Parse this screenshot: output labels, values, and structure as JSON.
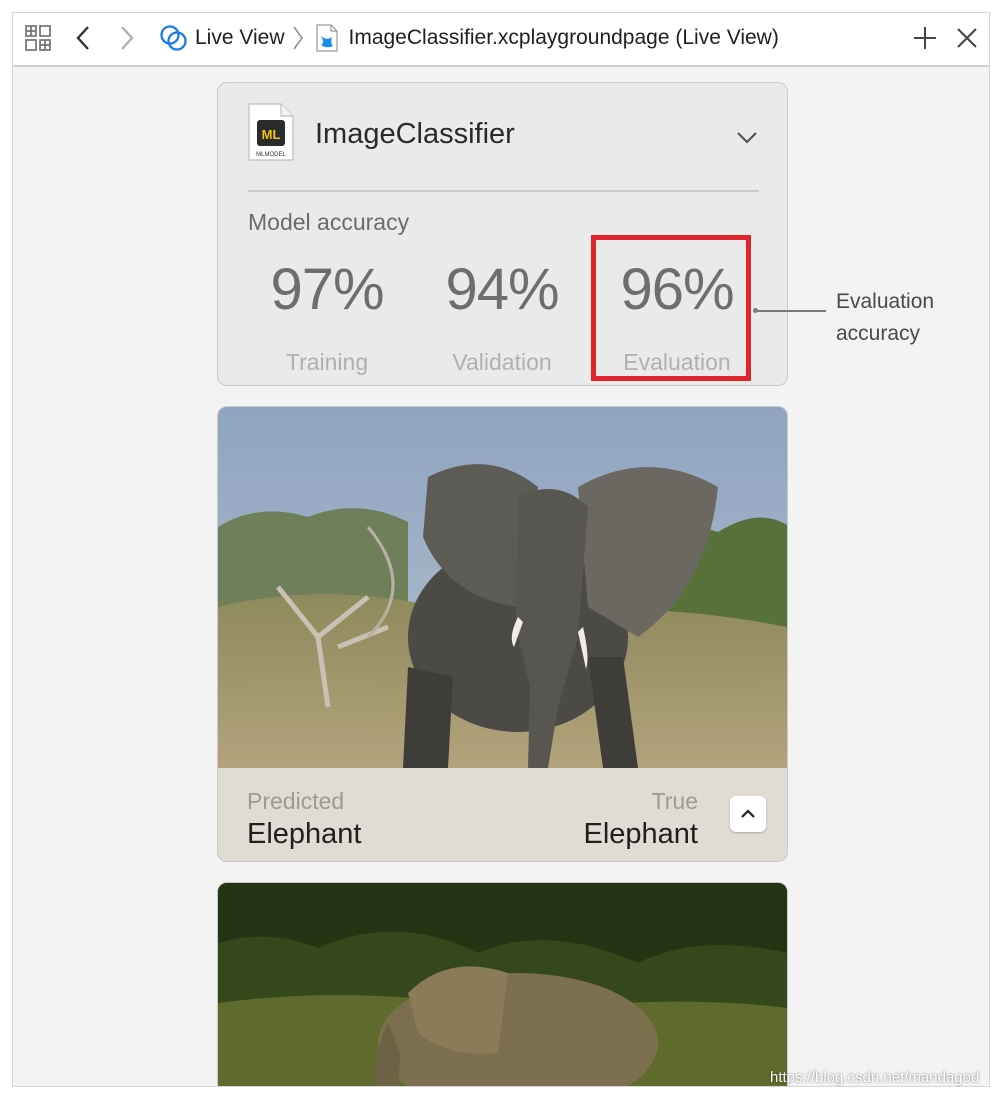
{
  "toolbar": {
    "grid_icon": "grid-icon",
    "back_icon": "chevron-left-icon",
    "forward_icon": "chevron-right-icon",
    "crumb1_icon": "live-view-icon",
    "crumb1": "Live View",
    "crumb_sep_icon": "breadcrumb-separator-icon",
    "crumb2_icon": "swift-file-icon",
    "crumb2": "ImageClassifier.xcplaygroundpage (Live View)",
    "add_icon": "plus-icon",
    "close_icon": "close-icon"
  },
  "model_card": {
    "icon_text": "ML",
    "icon_subtext": "MLMODEL",
    "name": "ImageClassifier",
    "section_label": "Model accuracy",
    "metrics": [
      {
        "value": "97%",
        "label": "Training"
      },
      {
        "value": "94%",
        "label": "Validation"
      },
      {
        "value": "96%",
        "label": "Evaluation"
      }
    ]
  },
  "annotation": {
    "line1": "Evaluation",
    "line2": "accuracy",
    "highlight_color": "#e0242b"
  },
  "image_cards": [
    {
      "predicted_label": "Predicted",
      "predicted_value": "Elephant",
      "true_label": "True",
      "true_value": "Elephant"
    }
  ],
  "watermark": "https://blog.csdn.net/mandagod",
  "colors": {
    "accent_blue": "#1a7ae8",
    "card_bg": "#eaeaea",
    "caption_bg": "#e1dcd3"
  }
}
